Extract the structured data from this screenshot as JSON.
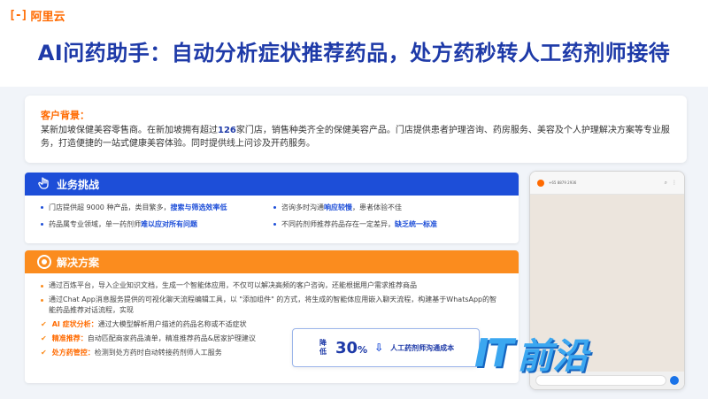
{
  "brand": {
    "logo_mark": "[-]",
    "logo_text": "阿里云"
  },
  "title": "AI问药助手：自动分析症状推荐药品，处方药秒转人工药剂师接待",
  "intro": {
    "label": "客户背景：",
    "p1": "某新加坡保健美容零售商。在新加坡拥有超过",
    "count": "126",
    "p2": "家门店，销售种类齐全的保健美容产品。门店提供患者护理咨询、药房服务、美容及个人护理解决方案等专业服务，打造便捷的一站式健康美容体验。同时提供线上问诊及开药服务。"
  },
  "challenges": {
    "heading": "业务挑战",
    "icon": "hand-pointer-icon",
    "items": [
      {
        "a": "门店提供超 9000 种产品，类目繁多，",
        "b": "搜索与筛选效率低"
      },
      {
        "a": "咨询多时沟通",
        "b": "响应较慢",
        "c": "，患者体验不佳"
      },
      {
        "a": "药品属专业领域，单一药剂师",
        "b": "难以应对所有问题"
      },
      {
        "a": "不同药剂师推荐药品存在一定差异，",
        "b": "缺乏统一标准"
      }
    ]
  },
  "solution": {
    "heading": "解决方案",
    "icon": "target-icon",
    "items": [
      {
        "text": "通过百炼平台，导入企业知识文档，生成一个智能体应用，不仅可以解决高频的客户咨询，还能根据用户需求推荐商品"
      },
      {
        "text": "通过Chat App消息服务提供的可视化聊天流程编辑工具，以 \"添加组件\" 的方式，将生成的智能体应用嵌入聊天流程，构建基于WhatsApp的智能药品推荐对话流程，实现"
      }
    ],
    "checks": [
      {
        "label": "AI 症状分析：",
        "text": "通过大模型解析用户描述的药品名称或不适症状"
      },
      {
        "label": "精准推荐：",
        "text": "自动匹配商家药品清单，精准推荐药品&居家护理建议"
      },
      {
        "label": "处方药管控：",
        "text": "检测到处方药时自动转接药剂师人工服务"
      }
    ]
  },
  "stat": {
    "label": "降低",
    "value": "30",
    "unit": "%",
    "desc": "人工药剂师沟通成本"
  },
  "phone": {
    "number": "+65 8879 2936",
    "icons": [
      "search-icon",
      "more-icon"
    ]
  },
  "watermark": {
    "latin": "IT",
    "cjk": "前沿"
  },
  "colors": {
    "brand_orange": "#ff6a00",
    "title_blue": "#1e3aa8",
    "challenge_blue": "#1d4ed8",
    "solution_orange": "#fb8c1e"
  }
}
